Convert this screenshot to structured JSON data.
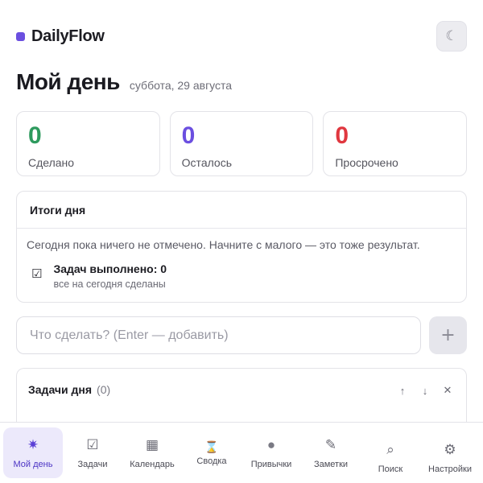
{
  "app": {
    "name": "DailyFlow",
    "accent": "#6b4fe0"
  },
  "header": {
    "theme_icon": "moon-icon",
    "theme_glyph": "☾"
  },
  "page": {
    "title": "Мой день",
    "date": "суббота, 29 августа"
  },
  "stats": [
    {
      "value": "0",
      "label": "Сделано",
      "color": "#2e9a5e"
    },
    {
      "value": "0",
      "label": "Осталось",
      "color": "#6b4fe0"
    },
    {
      "value": "0",
      "label": "Просрочено",
      "color": "#e0373f"
    }
  ],
  "summary": {
    "title": "Итоги дня",
    "text": "Сегодня пока ничего не отмечено. Начните с малого — это тоже результат.",
    "item": {
      "icon": "☑",
      "title": "Задач выполнено: 0",
      "subtitle": "все на сегодня сделаны"
    }
  },
  "task_input": {
    "placeholder": "Что сделать? (Enter — добавить)",
    "value": "",
    "add_label": "+"
  },
  "tasks": {
    "title": "Задачи дня",
    "count": "(0)",
    "actions": {
      "up": "↑",
      "down": "↓",
      "clear": "✕"
    }
  },
  "nav": [
    {
      "label": "Мой день",
      "icon": "sparkle-icon",
      "glyph": "✷",
      "active": true
    },
    {
      "label": "Задачи",
      "icon": "checkbox-icon",
      "glyph": "☑",
      "active": false
    },
    {
      "label": "Календарь",
      "icon": "calendar-grid-icon",
      "glyph": "▦",
      "active": false
    },
    {
      "label": "Сводка",
      "icon": "hourglass-icon",
      "glyph": "⌛",
      "active": false
    },
    {
      "label": "Привычки",
      "icon": "circle-icon",
      "glyph": "●",
      "active": false
    },
    {
      "label": "Заметки",
      "icon": "pencil-icon",
      "glyph": "✎",
      "active": false
    },
    {
      "label": "Поиск",
      "icon": "search-icon",
      "glyph": "⌕",
      "active": false
    },
    {
      "label": "Настройки",
      "icon": "gear-icon",
      "glyph": "⚙",
      "active": false
    }
  ]
}
